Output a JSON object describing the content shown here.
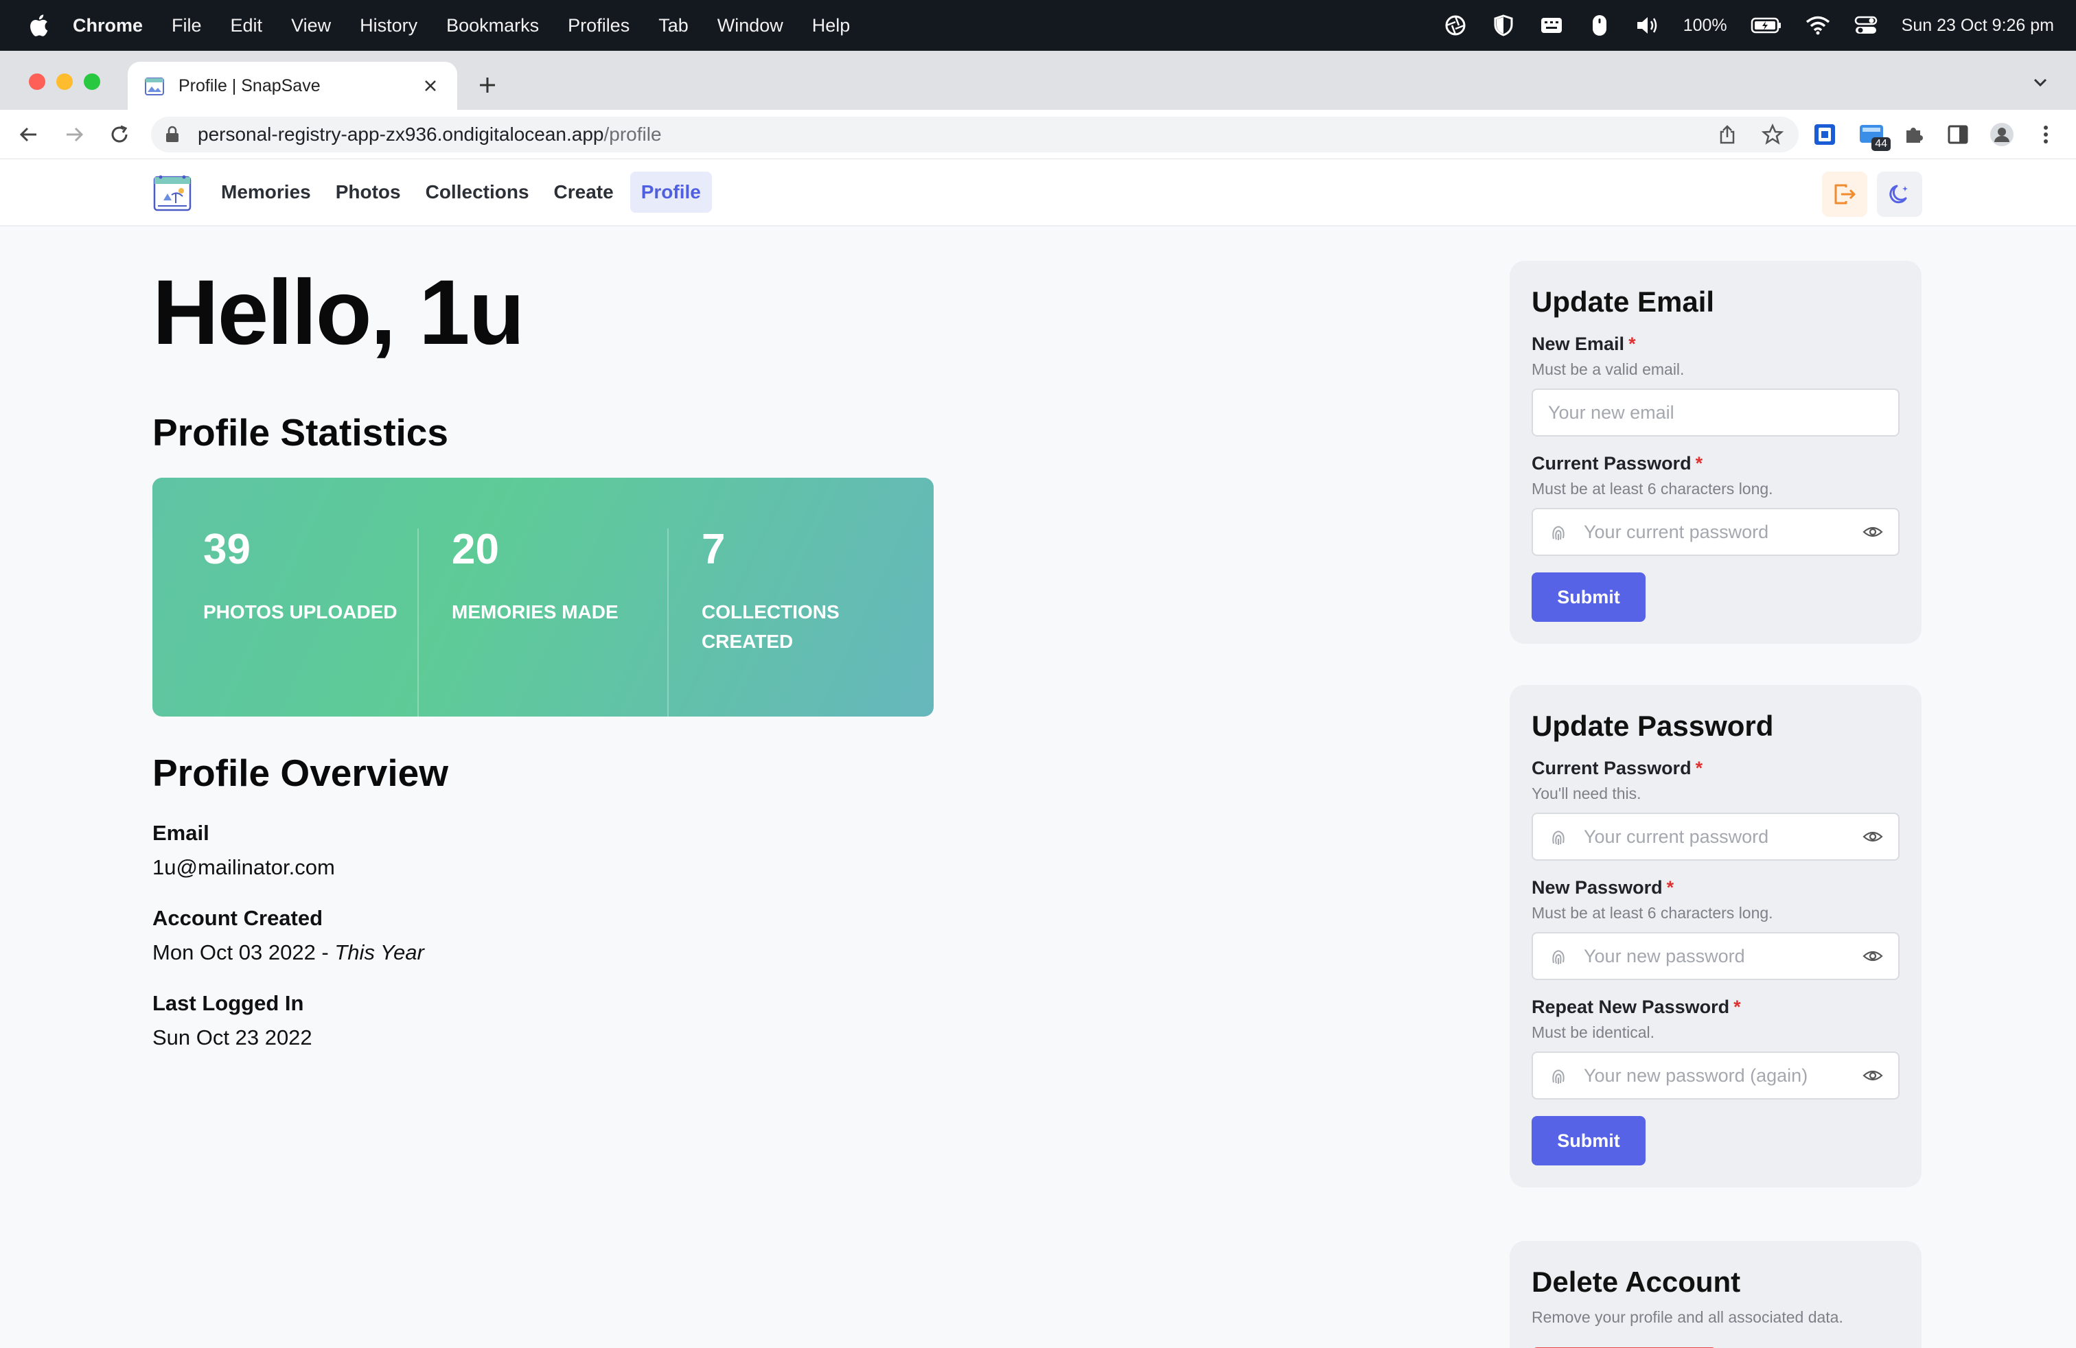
{
  "menubar": {
    "app_name": "Chrome",
    "items": [
      "File",
      "Edit",
      "View",
      "History",
      "Bookmarks",
      "Profiles",
      "Tab",
      "Window",
      "Help"
    ],
    "battery": "100%",
    "datetime": "Sun 23 Oct  9:26 pm"
  },
  "browser": {
    "tab_title": "Profile | SnapSave",
    "url_host": "personal-registry-app-zx936.ondigitalocean.app",
    "url_path": "/profile",
    "extension_badge": "44"
  },
  "nav": {
    "links": [
      "Memories",
      "Photos",
      "Collections",
      "Create",
      "Profile"
    ],
    "active": "Profile"
  },
  "greeting": "Hello, 1u",
  "stats_section": {
    "title": "Profile Statistics",
    "items": [
      {
        "value": "39",
        "label": "PHOTOS UPLOADED"
      },
      {
        "value": "20",
        "label": "MEMORIES MADE"
      },
      {
        "value": "7",
        "label": "COLLECTIONS CREATED"
      }
    ]
  },
  "overview": {
    "title": "Profile Overview",
    "email_label": "Email",
    "email_value": "1u@mailinator.com",
    "created_label": "Account Created",
    "created_value": "Mon Oct 03 2022 - ",
    "created_relative": "This Year",
    "last_login_label": "Last Logged In",
    "last_login_value": "Sun Oct 23 2022"
  },
  "update_email": {
    "title": "Update Email",
    "new_email_label": "New Email",
    "new_email_hint": "Must be a valid email.",
    "new_email_placeholder": "Your new email",
    "current_password_label": "Current Password",
    "current_password_hint": "Must be at least 6 characters long.",
    "current_password_placeholder": "Your current password",
    "submit_label": "Submit"
  },
  "update_password": {
    "title": "Update Password",
    "current_password_label": "Current Password",
    "current_password_hint": "You'll need this.",
    "current_password_placeholder": "Your current password",
    "new_password_label": "New Password",
    "new_password_hint": "Must be at least 6 characters long.",
    "new_password_placeholder": "Your new password",
    "repeat_password_label": "Repeat New Password",
    "repeat_password_hint": "Must be identical.",
    "repeat_password_placeholder": "Your new password (again)",
    "submit_label": "Submit"
  },
  "delete_account": {
    "title": "Delete Account",
    "subtitle": "Remove your profile and all associated data."
  },
  "required_marker": "*",
  "colors": {
    "accent": "#5663e6",
    "active_nav_bg": "#e8ebfa",
    "stats_gradient_start": "#5fc4a4",
    "stats_gradient_end": "#66b7bc",
    "required": "#e03131",
    "logout_icon": "#f08c2e",
    "danger": "#e64545"
  },
  "icons": {
    "logout": "logout-icon",
    "theme": "moon-icon",
    "password_field": "fingerprint-icon",
    "reveal": "eye-icon"
  }
}
